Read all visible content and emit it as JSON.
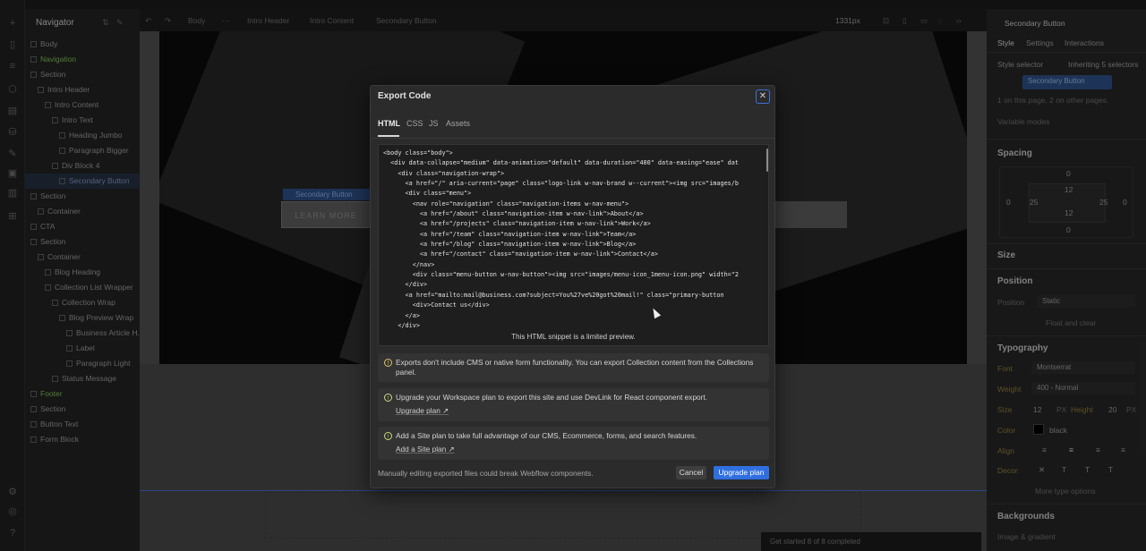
{
  "navigator": {
    "title": "Navigator",
    "items": [
      {
        "label": "Body",
        "depth": 0
      },
      {
        "label": "Navigation",
        "depth": 0,
        "accent": true
      },
      {
        "label": "Section",
        "depth": 0
      },
      {
        "label": "Intro Header",
        "depth": 1
      },
      {
        "label": "Intro Content",
        "depth": 2
      },
      {
        "label": "Intro Text",
        "depth": 3
      },
      {
        "label": "Heading Jumbo",
        "depth": 4
      },
      {
        "label": "Paragraph Bigger",
        "depth": 4
      },
      {
        "label": "Div Block 4",
        "depth": 3
      },
      {
        "label": "Secondary Button",
        "depth": 4,
        "selected": true
      },
      {
        "label": "Section",
        "depth": 0
      },
      {
        "label": "Container",
        "depth": 1
      },
      {
        "label": "CTA",
        "depth": 0
      },
      {
        "label": "Section",
        "depth": 0
      },
      {
        "label": "Container",
        "depth": 1
      },
      {
        "label": "Blog Heading",
        "depth": 2
      },
      {
        "label": "Collection List Wrapper",
        "depth": 2
      },
      {
        "label": "Collection Wrap",
        "depth": 3
      },
      {
        "label": "Blog Preview Wrap",
        "depth": 4
      },
      {
        "label": "Business Article H...",
        "depth": 5
      },
      {
        "label": "Label",
        "depth": 5
      },
      {
        "label": "Paragraph Light",
        "depth": 5
      },
      {
        "label": "Status Message",
        "depth": 3
      },
      {
        "label": "Footer",
        "depth": 0,
        "accent": true
      },
      {
        "label": "Section",
        "depth": 0
      },
      {
        "label": "Button Text",
        "depth": 0
      },
      {
        "label": "Form Block",
        "depth": 0
      }
    ]
  },
  "breadcrumb": {
    "items": [
      "Body",
      "···",
      "Intro Header",
      "Intro Content",
      "Secondary Button"
    ],
    "viewport": "1331px"
  },
  "canvas": {
    "selected_tag": "Secondary Button",
    "button_label": "LEARN MORE",
    "get_started": "Get started   8 of 8 completed"
  },
  "right_panel": {
    "title": "Secondary Button",
    "tabs": [
      "Style",
      "Settings",
      "Interactions"
    ],
    "style_selector_label": "Style selector",
    "inheriting": "Inheriting 5 selectors",
    "selector_chip": "Secondary Button",
    "usage_note": "1 on this page, 2 on other pages.",
    "variable_modes": "Variable modes",
    "spacing": {
      "title": "Spacing",
      "margin_top": "0",
      "padding_top": "12",
      "margin_left": "0",
      "padding_left": "25",
      "padding_right": "25",
      "margin_right": "0",
      "padding_bottom": "12",
      "margin_bottom": "0"
    },
    "size_title": "Size",
    "position_title": "Position",
    "position_label": "Position",
    "position_value": "Static",
    "float_clear": "Float and clear",
    "typography": {
      "title": "Typography",
      "font_label": "Font",
      "font_value": "Montserrat",
      "weight_label": "Weight",
      "weight_value": "400 - Normal",
      "size_label": "Size",
      "size_value": "12",
      "size_unit": "PX",
      "height_label": "Height",
      "height_value": "20",
      "height_unit": "PX",
      "color_label": "Color",
      "color_value": "black",
      "align_label": "Align",
      "decor_label": "Decor",
      "more_options": "More type options"
    },
    "backgrounds_title": "Backgrounds",
    "image_gradient": "Image & gradient"
  },
  "modal": {
    "title": "Export Code",
    "tabs": [
      "HTML",
      "CSS",
      "JS",
      "Assets"
    ],
    "code_lines": [
      "<body class=\"body\">",
      "  <div data-collapse=\"medium\" data-animation=\"default\" data-duration=\"400\" data-easing=\"ease\" dat",
      "    <div class=\"navigation-wrap\">",
      "      <a href=\"/\" aria-current=\"page\" class=\"logo-link w-nav-brand w--current\"><img src=\"images/b",
      "      <div class=\"menu\">",
      "        <nav role=\"navigation\" class=\"navigation-items w-nav-menu\">",
      "          <a href=\"/about\" class=\"navigation-item w-nav-link\">About</a>",
      "          <a href=\"/projects\" class=\"navigation-item w-nav-link\">Work</a>",
      "          <a href=\"/team\" class=\"navigation-item w-nav-link\">Team</a>",
      "          <a href=\"/blog\" class=\"navigation-item w-nav-link\">Blog</a>",
      "          <a href=\"/contact\" class=\"navigation-item w-nav-link\">Contact</a>",
      "        </nav>",
      "        <div class=\"menu-button w-nav-button\"><img src=\"images/menu-icon_1menu-icon.png\" width=\"2",
      "      </div>",
      "      <a href=\"mailto:mail@business.com?subject=You%27ve%20got%20mail!\" class=\"primary-button",
      "        <div>Contact us</div>",
      "      </a>",
      "    </div>"
    ],
    "preview_note": "This HTML snippet is a limited preview.",
    "info_1": "Exports don't include CMS or native form functionality. You can export Collection content from the Collections panel.",
    "info_2": "Upgrade your Workspace plan to export this site and use DevLink for React component export.",
    "info_2_link": "Upgrade plan ↗",
    "info_3": "Add a Site plan to take full advantage of our CMS, Ecommerce, forms, and search features.",
    "info_3_link": "Add a Site plan ↗",
    "footer_note": "Manually editing exported files could break Webflow components.",
    "cancel_label": "Cancel",
    "upgrade_label": "Upgrade plan"
  },
  "colors": {
    "accent": "#2f6fe0",
    "navigator_accent": "#7fbf54",
    "selected": "#253043"
  }
}
